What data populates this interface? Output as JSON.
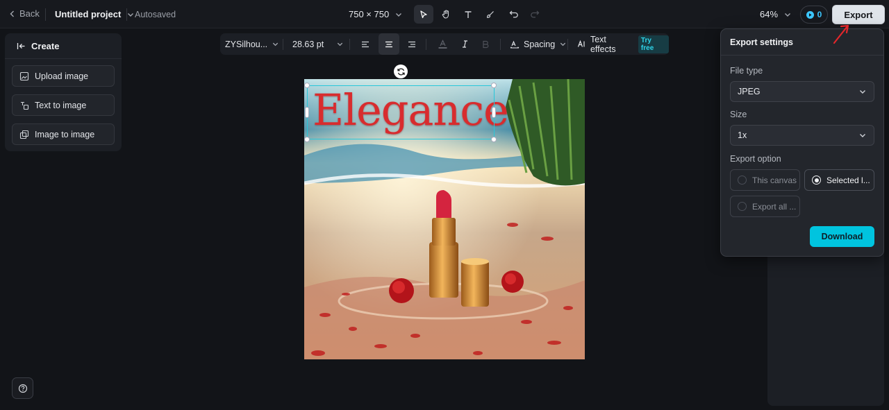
{
  "topbar": {
    "back_label": "Back",
    "project_name": "Untitled project",
    "save_status": "Autosaved",
    "canvas_size": "750 × 750",
    "zoom": "64%",
    "credits": "0",
    "export_label": "Export"
  },
  "left_panel": {
    "title": "Create",
    "buttons": [
      {
        "label": "Upload image",
        "icon": "upload-image-icon"
      },
      {
        "label": "Text to image",
        "icon": "text-to-image-icon"
      },
      {
        "label": "Image to image",
        "icon": "image-to-image-icon"
      }
    ]
  },
  "text_toolbar": {
    "font": "ZYSilhou...",
    "font_size": "28.63 pt",
    "spacing_label": "Spacing",
    "text_effects_label": "Text effects",
    "try_free_label": "Try free"
  },
  "canvas": {
    "headline_text": "Elegance",
    "headline_color": "#d82c2e"
  },
  "export_settings": {
    "title": "Export settings",
    "file_type_label": "File type",
    "file_type_value": "JPEG",
    "size_label": "Size",
    "size_value": "1x",
    "export_option_label": "Export option",
    "options": [
      {
        "label": "This canvas",
        "selected": false
      },
      {
        "label": "Selected l...",
        "selected": true
      },
      {
        "label": "Export all ...",
        "selected": false
      }
    ],
    "download_label": "Download"
  },
  "colors": {
    "accent": "#00c4df",
    "background": "#121418",
    "panel": "#1c1f25"
  }
}
